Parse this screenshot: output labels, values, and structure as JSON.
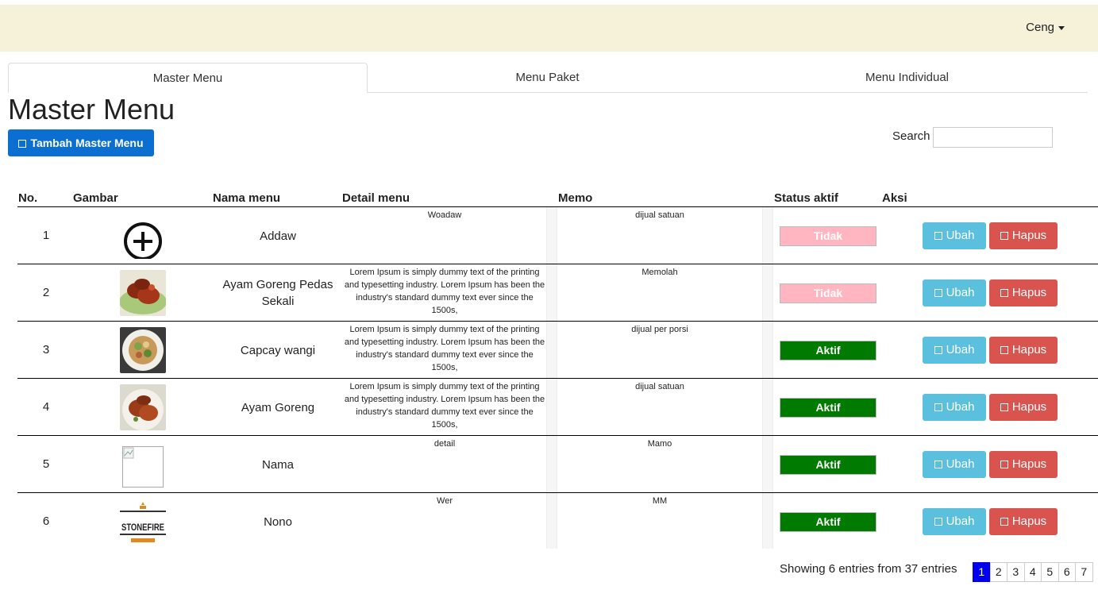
{
  "header": {
    "user_name": "Ceng"
  },
  "tabs": [
    {
      "label": "Master Menu"
    },
    {
      "label": "Menu Paket"
    },
    {
      "label": "Menu Individual"
    }
  ],
  "page": {
    "title": "Master Menu",
    "add_button_label": "Tambah Master Menu",
    "search_label": "Search",
    "search_value": ""
  },
  "table": {
    "columns": [
      "No.",
      "Gambar",
      "Nama menu",
      "Detail menu",
      "Memo",
      "Status aktif",
      "Aksi"
    ],
    "rows": [
      {
        "no": "1",
        "image": "plus-circle-icon",
        "name": "Addaw",
        "detail": "Woadaw",
        "memo": "dijual satuan",
        "status": "Tidak",
        "status_color": "#ffb6c1",
        "edit": "Ubah",
        "delete": "Hapus"
      },
      {
        "no": "2",
        "image": "fried-chicken-photo",
        "name": "Ayam Goreng Pedas Sekali",
        "detail": "Lorem Ipsum is simply dummy text of the printing and typesetting industry. Lorem Ipsum has been the industry's standard dummy text ever since the 1500s,",
        "memo": "Memolah",
        "status": "Tidak",
        "status_color": "#ffb6c1",
        "edit": "Ubah",
        "delete": "Hapus"
      },
      {
        "no": "3",
        "image": "capcay-photo",
        "name": "Capcay wangi",
        "detail": "Lorem Ipsum is simply dummy text of the printing and typesetting industry. Lorem Ipsum has been the industry's standard dummy text ever since the 1500s,",
        "memo": "dijual per porsi",
        "status": "Aktif",
        "status_color": "#007a00",
        "edit": "Ubah",
        "delete": "Hapus"
      },
      {
        "no": "4",
        "image": "fried-chicken-photo",
        "name": "Ayam Goreng",
        "detail": "Lorem Ipsum is simply dummy text of the printing and typesetting industry. Lorem Ipsum has been the industry's standard dummy text ever since the 1500s,",
        "memo": "dijual satuan",
        "status": "Aktif",
        "status_color": "#007a00",
        "edit": "Ubah",
        "delete": "Hapus"
      },
      {
        "no": "5",
        "image": "broken-image-icon",
        "name": "Nama",
        "detail": "detail",
        "memo": "Mamo",
        "status": "Aktif",
        "status_color": "#007a00",
        "edit": "Ubah",
        "delete": "Hapus"
      },
      {
        "no": "6",
        "image": "stonefire-logo",
        "name": "Nono",
        "detail": "Wer",
        "memo": "MM",
        "status": "Aktif",
        "status_color": "#007a00",
        "edit": "Ubah",
        "delete": "Hapus"
      }
    ]
  },
  "footer": {
    "showing_text": "Showing 6 entries from 37 entries",
    "pages": [
      "1",
      "2",
      "3",
      "4",
      "5",
      "6",
      "7"
    ],
    "active_page": "1"
  },
  "logo_text": "STONEFIRE"
}
